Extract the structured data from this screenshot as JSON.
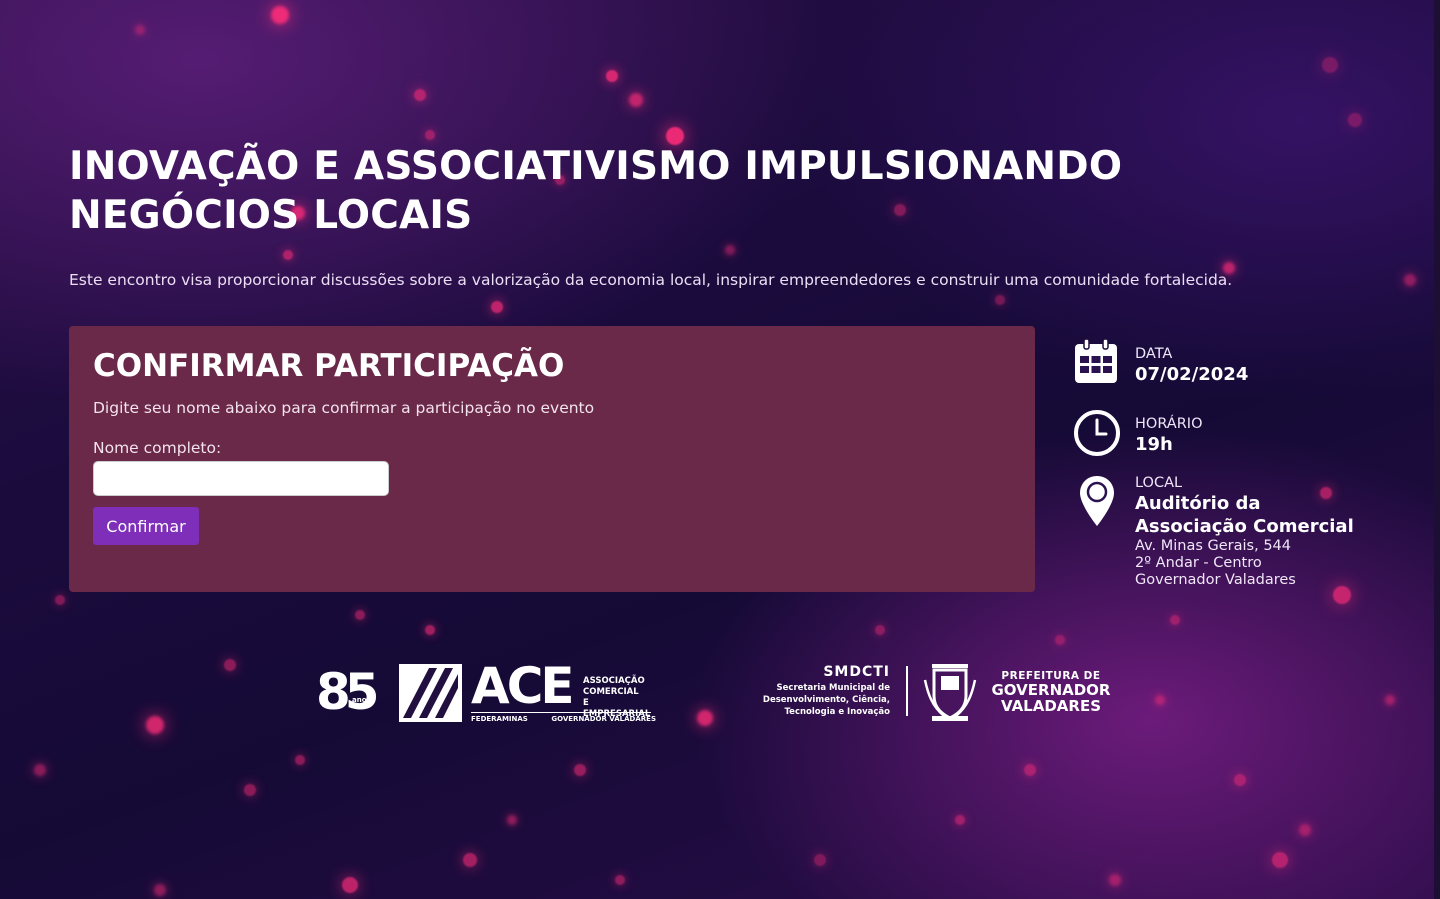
{
  "hero": {
    "title": "INOVAÇÃO E ASSOCIATIVISMO IMPULSIONANDO NEGÓCIOS LOCAIS",
    "description": "Este encontro visa proporcionar discussões sobre a valorização da economia local, inspirar empreendedores e construir uma comunidade fortalecida."
  },
  "form": {
    "heading": "CONFIRMAR PARTICIPAÇÃO",
    "subtitle": "Digite seu nome abaixo para confirmar a participação no evento",
    "name_label": "Nome completo:",
    "name_value": "",
    "submit_label": "Confirmar"
  },
  "event_info": {
    "date": {
      "icon": "calendar-icon",
      "label": "DATA",
      "value": "07/02/2024"
    },
    "time": {
      "icon": "clock-icon",
      "label": "HORÁRIO",
      "value": "19h"
    },
    "location": {
      "icon": "map-pin-icon",
      "label": "LOCAL",
      "venue_line1": "Auditório da",
      "venue_line2": "Associação Comercial",
      "address_line1": "Av. Minas Gerais, 544",
      "address_line2": "2º Andar - Centro",
      "address_line3": "Governador Valadares"
    }
  },
  "logos": {
    "ace": {
      "years": "85",
      "years_caption": "anos",
      "name": "ACE",
      "sub_line1": "ASSOCIAÇÃO",
      "sub_line2": "COMERCIAL",
      "sub_line3": "E EMPRESARIAL",
      "footer_left": "FEDERAMINAS",
      "footer_right": "GOVERNADOR VALADARES"
    },
    "prefeitura": {
      "smdcti": "SMDCTI",
      "smdcti_line1": "Secretaria Municipal de",
      "smdcti_line2": "Desenvolvimento, Ciência,",
      "smdcti_line3": "Tecnologia e Inovação",
      "pref_line1": "PREFEITURA DE",
      "pref_line2": "GOVERNADOR",
      "pref_line3": "VALADARES"
    }
  },
  "theme": {
    "card_color": "#6a2949",
    "button_color": "#7e2eb8",
    "bokeh_color": "#ff2d7a"
  }
}
